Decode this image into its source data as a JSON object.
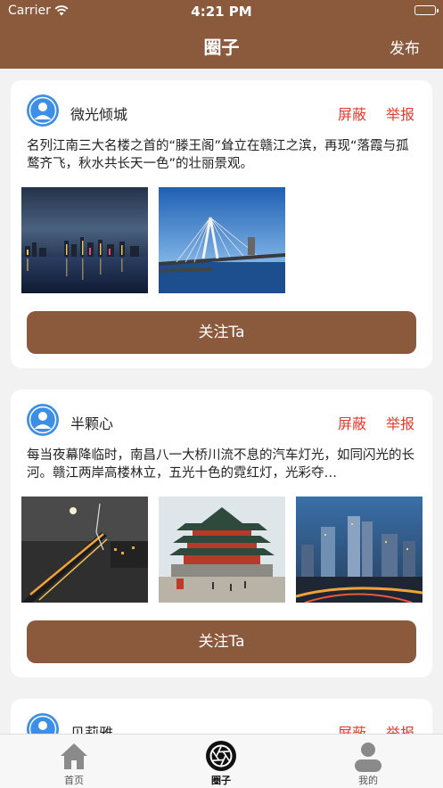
{
  "status_bar": {
    "carrier": "Carrier",
    "time": "4:21 PM"
  },
  "nav": {
    "title": "圈子",
    "publish": "发布"
  },
  "posts": [
    {
      "username": "微光倾城",
      "block": "屏蔽",
      "report": "举报",
      "text": "名列江南三大名楼之首的“滕王阁”耸立在赣江之滨，再现“落霞与孤鹜齐飞，秋水共长天一色”的壮丽景观。",
      "follow": "关注Ta"
    },
    {
      "username": "半颗心",
      "block": "屏蔽",
      "report": "举报",
      "text": "每当夜幕降临时，南昌八一大桥川流不息的汽车灯光，如同闪光的长河。赣江两岸高楼林立，五光十色的霓红灯，光彩夺…",
      "follow": "关注Ta"
    },
    {
      "username": "贝莉雅",
      "block": "屏蔽",
      "report": "举报"
    }
  ],
  "tabs": [
    {
      "label": "首页"
    },
    {
      "label": "圈子"
    },
    {
      "label": "我的"
    }
  ],
  "colors": {
    "brand": "#8b5a3c",
    "danger": "#e53b2e",
    "avatar": "#3d8fe6"
  }
}
